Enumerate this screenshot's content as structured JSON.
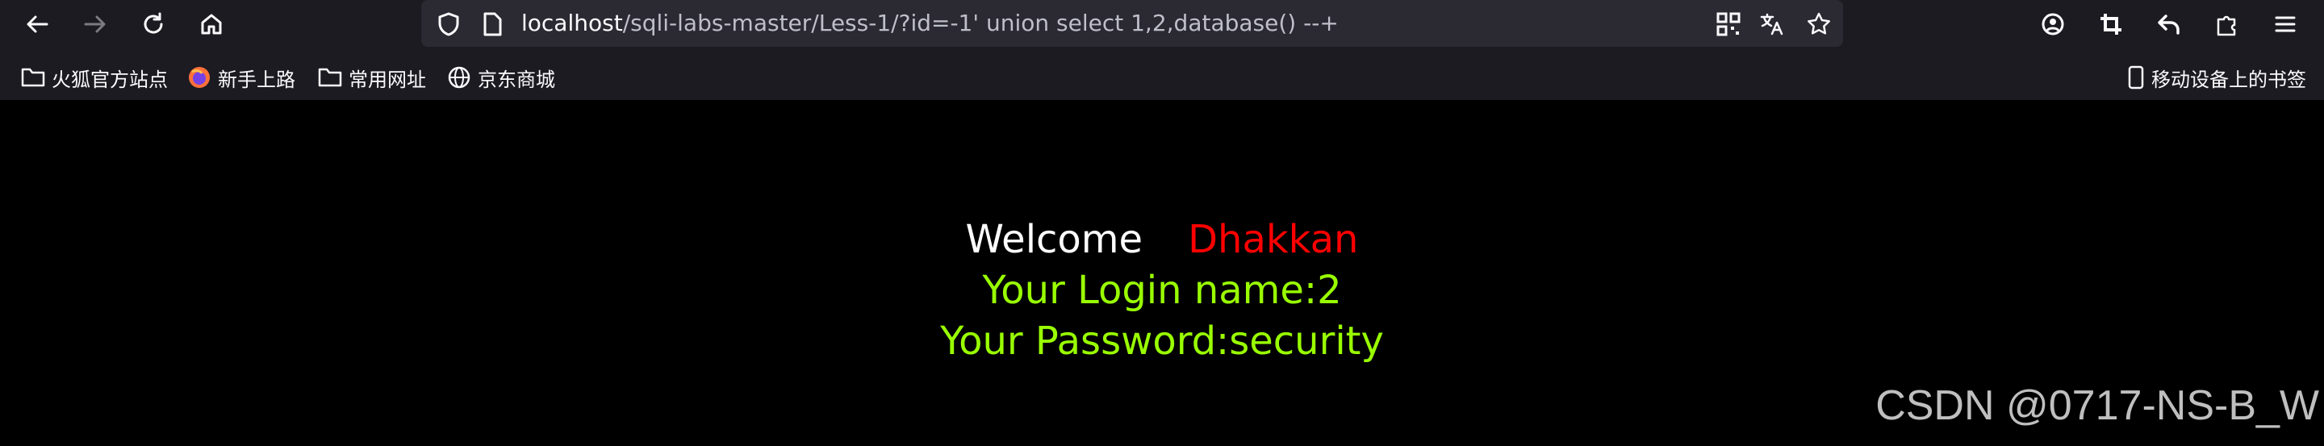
{
  "browser": {
    "url_host": "localhost",
    "url_path": "/sqli-labs-master/Less-1/?id=-1' union select 1,2,database() --+",
    "bookmarks": [
      {
        "label": "火狐官方站点",
        "icon": "folder-icon"
      },
      {
        "label": "新手上路",
        "icon": "firefox-icon"
      },
      {
        "label": "常用网址",
        "icon": "folder-icon"
      },
      {
        "label": "京东商城",
        "icon": "globe-icon"
      }
    ],
    "mobile_bookmarks": "移动设备上的书签"
  },
  "page": {
    "welcome": "Welcome",
    "username": "Dhakkan",
    "login_line": "Your Login name:2",
    "password_line": "Your Password:security"
  },
  "watermark": "CSDN @0717-NS-B_W",
  "colors": {
    "toolbar_bg": "#1c1b22",
    "urlbar_bg": "#2b2a33",
    "welcome": "#ffffff",
    "username": "#ff0000",
    "result": "#99ff00"
  }
}
